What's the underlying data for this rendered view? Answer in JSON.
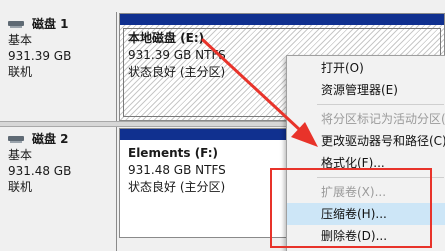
{
  "disks": [
    {
      "name": "磁盘 1",
      "type": "基本",
      "size": "931.39 GB",
      "status": "联机"
    },
    {
      "name": "磁盘 2",
      "type": "基本",
      "size": "931.48 GB",
      "status": "联机"
    }
  ],
  "partitions": [
    {
      "name": "本地磁盘  (E:)",
      "size_fs": "931.39 GB NTFS",
      "status": "状态良好 (主分区)"
    },
    {
      "name": "Elements  (F:)",
      "size_fs": "931.48 GB NTFS",
      "status": "状态良好 (主分区)"
    }
  ],
  "context_menu": {
    "items": [
      {
        "label": "打开(O)",
        "enabled": true
      },
      {
        "label": "资源管理器(E)",
        "enabled": true
      },
      {
        "label": "将分区标记为活动分区(M)",
        "enabled": false
      },
      {
        "label": "更改驱动器号和路径(C)...",
        "enabled": true
      },
      {
        "label": "格式化(F)...",
        "enabled": true
      },
      {
        "label": "扩展卷(X)...",
        "enabled": false
      },
      {
        "label": "压缩卷(H)...",
        "enabled": true,
        "highlighted": true
      },
      {
        "label": "删除卷(D)...",
        "enabled": true
      }
    ]
  },
  "annotation_color": "#e8332a",
  "partition_bar_color": "#10308f"
}
